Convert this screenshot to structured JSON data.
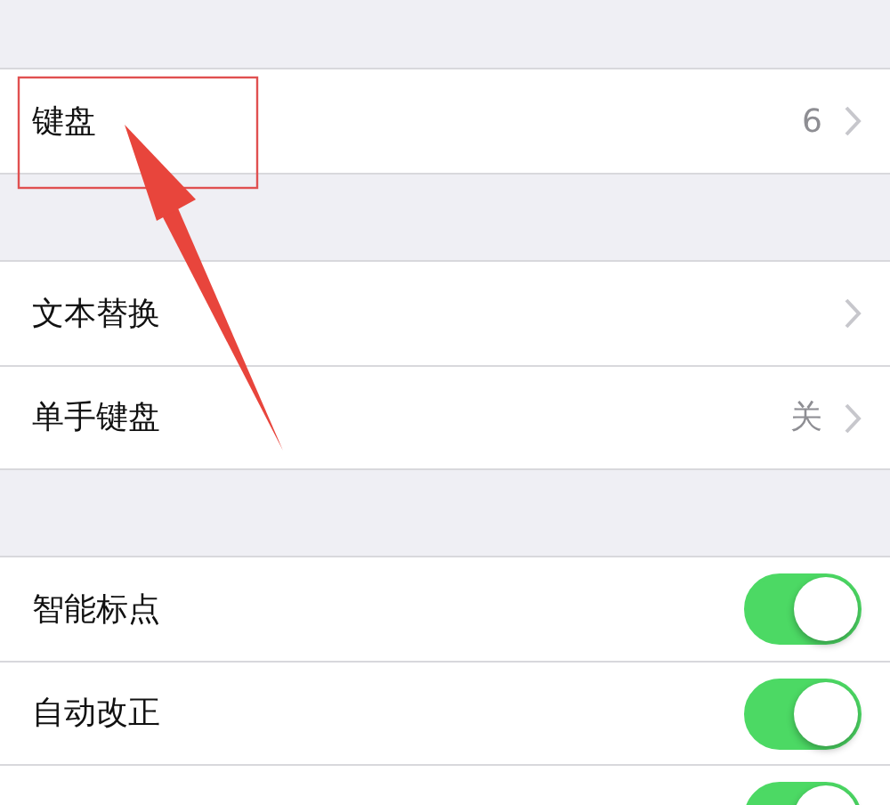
{
  "groups": [
    {
      "rows": [
        {
          "kind": "link",
          "label": "键盘",
          "value": "6"
        }
      ]
    },
    {
      "rows": [
        {
          "kind": "link",
          "label": "文本替换"
        },
        {
          "kind": "link",
          "label": "单手键盘",
          "value": "关"
        }
      ]
    },
    {
      "rows": [
        {
          "kind": "toggle",
          "label": "智能标点",
          "on": true
        },
        {
          "kind": "toggle",
          "label": "自动改正",
          "on": true
        },
        {
          "kind": "toggle",
          "on": true
        }
      ]
    }
  ]
}
